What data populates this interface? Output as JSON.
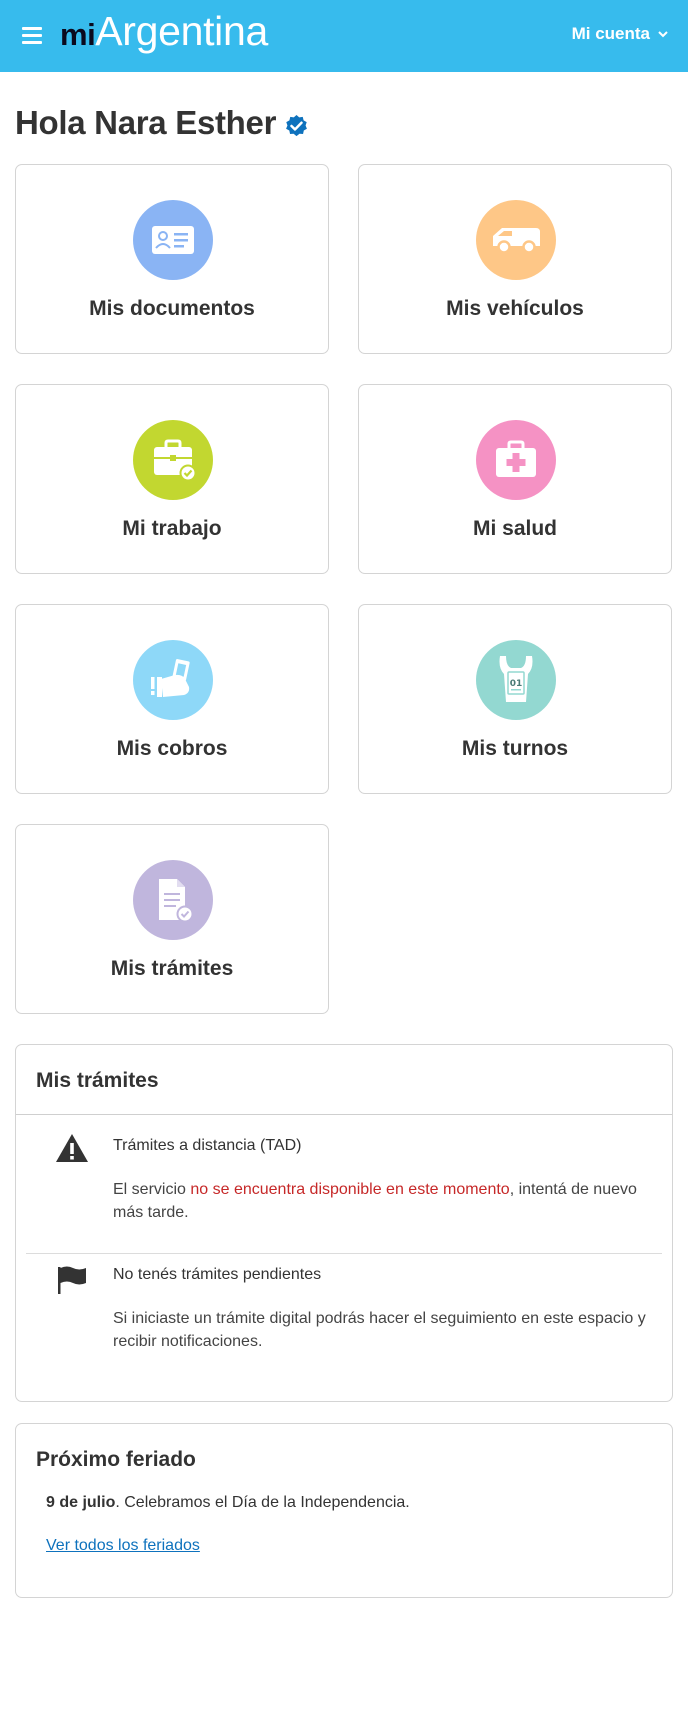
{
  "header": {
    "logo_mi": "mi",
    "logo_argentina": "Argentina",
    "account_label": "Mi cuenta",
    "bg_color": "#37bbed"
  },
  "greeting": {
    "text": "Hola Nara Esther"
  },
  "cards": [
    {
      "label": "Mis documentos",
      "icon": "id-card-icon",
      "color": "#8ab4f4"
    },
    {
      "label": "Mis vehículos",
      "icon": "van-icon",
      "color": "#fec787"
    },
    {
      "label": "Mi trabajo",
      "icon": "briefcase-icon",
      "color": "#c2d730"
    },
    {
      "label": "Mi salud",
      "icon": "first-aid-kit-icon",
      "color": "#f592c4"
    },
    {
      "label": "Mis cobros",
      "icon": "hand-money-icon",
      "color": "#8ed8f8"
    },
    {
      "label": "Mis turnos",
      "icon": "ticket-hand-icon",
      "color": "#93d8d1"
    },
    {
      "label": "Mis trámites",
      "icon": "document-check-icon",
      "color": "#c0b6dd"
    }
  ],
  "tramites_panel": {
    "title": "Mis trámites",
    "items": [
      {
        "title": "Trámites a distancia (TAD)",
        "body_prefix": "El servicio ",
        "body_highlight": "no se encuentra disponible en este momento",
        "body_suffix": ", intentá de nuevo más tarde.",
        "icon": "warning-icon"
      },
      {
        "title": "No tenés trámites pendientes",
        "body": "Si iniciaste un trámite digital podrás hacer el seguimiento en este espacio y recibir notificaciones.",
        "icon": "flag-icon"
      }
    ]
  },
  "feriado_panel": {
    "title": "Próximo feriado",
    "date": "9 de julio",
    "description": ". Celebramos el Día de la Independencia.",
    "link": "Ver todos los feriados"
  }
}
